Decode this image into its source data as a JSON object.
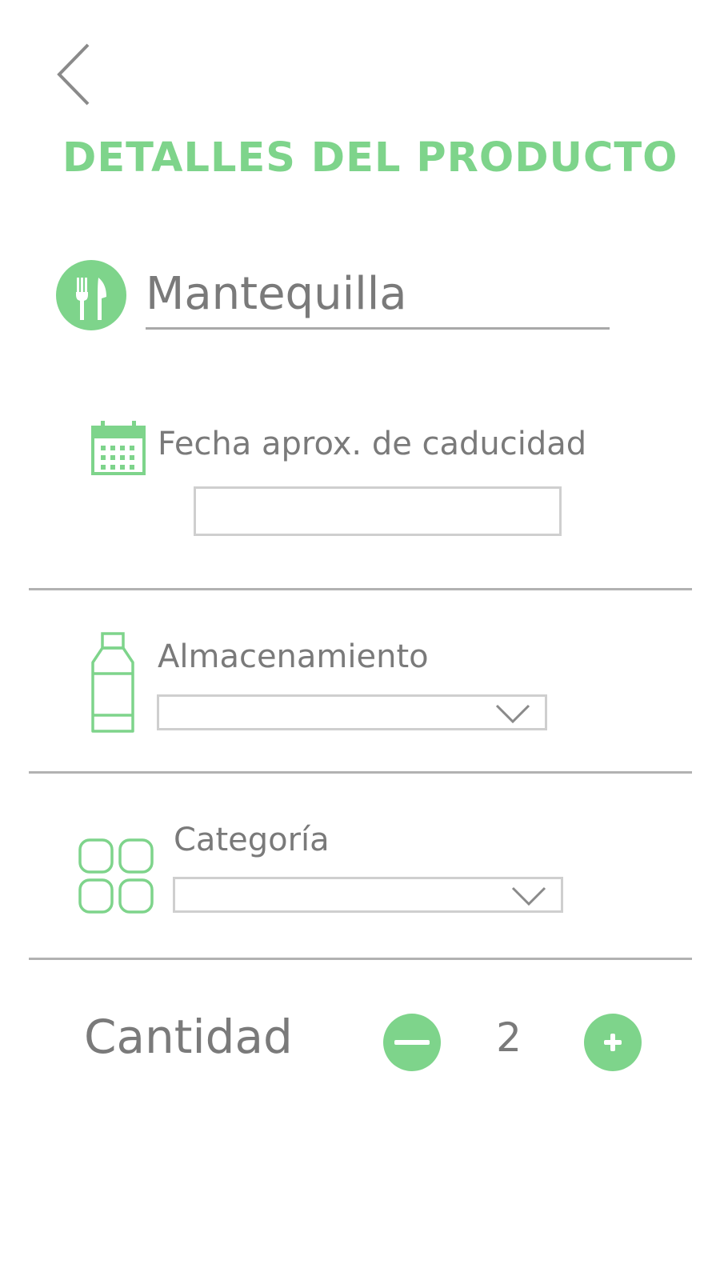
{
  "header": {
    "back_icon": "chevron-left-icon",
    "title": "DETALLES DEL PRODUCTO"
  },
  "product": {
    "icon": "fork-knife-icon",
    "name_value": "Mantequilla"
  },
  "expiry": {
    "icon": "calendar-icon",
    "label": "Fecha aprox. de caducidad",
    "value": ""
  },
  "storage": {
    "icon": "bottle-icon",
    "label": "Almacenamiento",
    "selected": ""
  },
  "category": {
    "icon": "grid-icon",
    "label": "Categoría",
    "selected": ""
  },
  "quantity": {
    "label": "Cantidad",
    "value": "2",
    "decrement_icon": "minus-icon",
    "increment_icon": "plus-icon"
  },
  "colors": {
    "accent": "#7ed48b",
    "text": "#7a7a7a",
    "divider": "#b2b2b2",
    "field_border": "#cfcfcf"
  }
}
